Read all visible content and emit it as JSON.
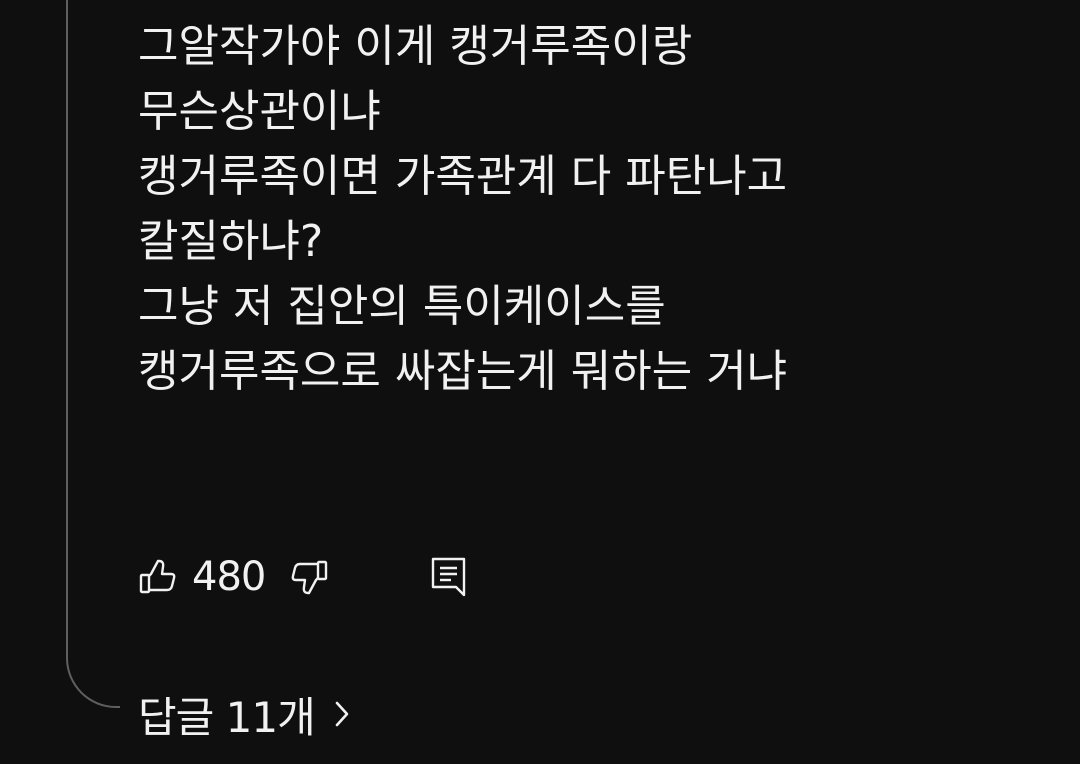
{
  "comment": {
    "lines": [
      "그알작가야 이게 캥거루족이랑",
      "무슨상관이냐",
      "캥거루족이면 가족관계 다 파탄나고",
      "칼질하냐?",
      "그냥 저 집안의 특이케이스를",
      "캥거루족으로 싸잡는게 뭐하는 거냐"
    ]
  },
  "actions": {
    "like_icon": "thumbs-up-icon",
    "like_count": "480",
    "dislike_icon": "thumbs-down-icon",
    "reply_icon": "reply-comment-icon"
  },
  "replies": {
    "label": "답글 11개",
    "chevron_icon": "chevron-right-icon"
  },
  "colors": {
    "background": "#0f0f0f",
    "text": "#f1f1f1",
    "thread_line": "#5f5f5f"
  }
}
